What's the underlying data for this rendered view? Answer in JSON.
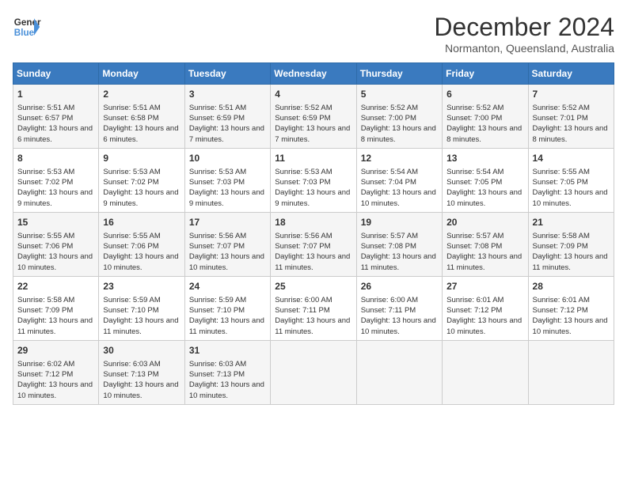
{
  "logo": {
    "line1": "General",
    "line2": "Blue"
  },
  "title": "December 2024",
  "subtitle": "Normanton, Queensland, Australia",
  "days_of_week": [
    "Sunday",
    "Monday",
    "Tuesday",
    "Wednesday",
    "Thursday",
    "Friday",
    "Saturday"
  ],
  "weeks": [
    [
      {
        "day": "1",
        "sunrise": "5:51 AM",
        "sunset": "6:57 PM",
        "daylight": "13 hours and 6 minutes."
      },
      {
        "day": "2",
        "sunrise": "5:51 AM",
        "sunset": "6:58 PM",
        "daylight": "13 hours and 6 minutes."
      },
      {
        "day": "3",
        "sunrise": "5:51 AM",
        "sunset": "6:59 PM",
        "daylight": "13 hours and 7 minutes."
      },
      {
        "day": "4",
        "sunrise": "5:52 AM",
        "sunset": "6:59 PM",
        "daylight": "13 hours and 7 minutes."
      },
      {
        "day": "5",
        "sunrise": "5:52 AM",
        "sunset": "7:00 PM",
        "daylight": "13 hours and 8 minutes."
      },
      {
        "day": "6",
        "sunrise": "5:52 AM",
        "sunset": "7:00 PM",
        "daylight": "13 hours and 8 minutes."
      },
      {
        "day": "7",
        "sunrise": "5:52 AM",
        "sunset": "7:01 PM",
        "daylight": "13 hours and 8 minutes."
      }
    ],
    [
      {
        "day": "8",
        "sunrise": "5:53 AM",
        "sunset": "7:02 PM",
        "daylight": "13 hours and 9 minutes."
      },
      {
        "day": "9",
        "sunrise": "5:53 AM",
        "sunset": "7:02 PM",
        "daylight": "13 hours and 9 minutes."
      },
      {
        "day": "10",
        "sunrise": "5:53 AM",
        "sunset": "7:03 PM",
        "daylight": "13 hours and 9 minutes."
      },
      {
        "day": "11",
        "sunrise": "5:53 AM",
        "sunset": "7:03 PM",
        "daylight": "13 hours and 9 minutes."
      },
      {
        "day": "12",
        "sunrise": "5:54 AM",
        "sunset": "7:04 PM",
        "daylight": "13 hours and 10 minutes."
      },
      {
        "day": "13",
        "sunrise": "5:54 AM",
        "sunset": "7:05 PM",
        "daylight": "13 hours and 10 minutes."
      },
      {
        "day": "14",
        "sunrise": "5:55 AM",
        "sunset": "7:05 PM",
        "daylight": "13 hours and 10 minutes."
      }
    ],
    [
      {
        "day": "15",
        "sunrise": "5:55 AM",
        "sunset": "7:06 PM",
        "daylight": "13 hours and 10 minutes."
      },
      {
        "day": "16",
        "sunrise": "5:55 AM",
        "sunset": "7:06 PM",
        "daylight": "13 hours and 10 minutes."
      },
      {
        "day": "17",
        "sunrise": "5:56 AM",
        "sunset": "7:07 PM",
        "daylight": "13 hours and 10 minutes."
      },
      {
        "day": "18",
        "sunrise": "5:56 AM",
        "sunset": "7:07 PM",
        "daylight": "13 hours and 11 minutes."
      },
      {
        "day": "19",
        "sunrise": "5:57 AM",
        "sunset": "7:08 PM",
        "daylight": "13 hours and 11 minutes."
      },
      {
        "day": "20",
        "sunrise": "5:57 AM",
        "sunset": "7:08 PM",
        "daylight": "13 hours and 11 minutes."
      },
      {
        "day": "21",
        "sunrise": "5:58 AM",
        "sunset": "7:09 PM",
        "daylight": "13 hours and 11 minutes."
      }
    ],
    [
      {
        "day": "22",
        "sunrise": "5:58 AM",
        "sunset": "7:09 PM",
        "daylight": "13 hours and 11 minutes."
      },
      {
        "day": "23",
        "sunrise": "5:59 AM",
        "sunset": "7:10 PM",
        "daylight": "13 hours and 11 minutes."
      },
      {
        "day": "24",
        "sunrise": "5:59 AM",
        "sunset": "7:10 PM",
        "daylight": "13 hours and 11 minutes."
      },
      {
        "day": "25",
        "sunrise": "6:00 AM",
        "sunset": "7:11 PM",
        "daylight": "13 hours and 11 minutes."
      },
      {
        "day": "26",
        "sunrise": "6:00 AM",
        "sunset": "7:11 PM",
        "daylight": "13 hours and 10 minutes."
      },
      {
        "day": "27",
        "sunrise": "6:01 AM",
        "sunset": "7:12 PM",
        "daylight": "13 hours and 10 minutes."
      },
      {
        "day": "28",
        "sunrise": "6:01 AM",
        "sunset": "7:12 PM",
        "daylight": "13 hours and 10 minutes."
      }
    ],
    [
      {
        "day": "29",
        "sunrise": "6:02 AM",
        "sunset": "7:12 PM",
        "daylight": "13 hours and 10 minutes."
      },
      {
        "day": "30",
        "sunrise": "6:03 AM",
        "sunset": "7:13 PM",
        "daylight": "13 hours and 10 minutes."
      },
      {
        "day": "31",
        "sunrise": "6:03 AM",
        "sunset": "7:13 PM",
        "daylight": "13 hours and 10 minutes."
      },
      null,
      null,
      null,
      null
    ]
  ],
  "labels": {
    "sunrise": "Sunrise:",
    "sunset": "Sunset:",
    "daylight": "Daylight:"
  }
}
